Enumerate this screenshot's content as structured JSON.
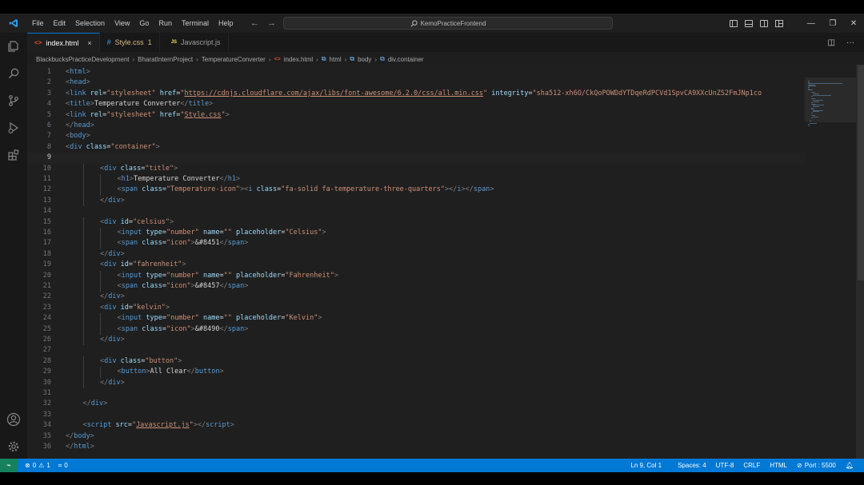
{
  "menu": [
    "File",
    "Edit",
    "Selection",
    "View",
    "Go",
    "Run",
    "Terminal",
    "Help"
  ],
  "command_center": {
    "text": "KemoPracticeFrontend"
  },
  "tabs": [
    {
      "label": "index.html",
      "icon": "html-file-icon",
      "active": true,
      "close": "×"
    },
    {
      "label": "Style.css",
      "icon": "css-file-icon",
      "badge": "1"
    },
    {
      "label": "Javascript.js",
      "icon": "js-file-icon"
    }
  ],
  "breadcrumb": [
    "BlackbucksPracticeDevelopment",
    "BharatInternProject",
    "TemperatureConverter",
    "index.html",
    "html",
    "body",
    "div.container"
  ],
  "editor": {
    "current_line": 9,
    "lines": [
      {
        "n": "1",
        "i": 0,
        "t": [
          [
            "p",
            "<"
          ],
          [
            "g",
            "html"
          ],
          [
            "p",
            ">"
          ]
        ]
      },
      {
        "n": "2",
        "i": 0,
        "t": [
          [
            "p",
            "<"
          ],
          [
            "g",
            "head"
          ],
          [
            "p",
            ">"
          ]
        ]
      },
      {
        "n": "3",
        "i": 0,
        "t": [
          [
            "p",
            "<"
          ],
          [
            "g",
            "link "
          ],
          [
            "a",
            "rel"
          ],
          [
            "x",
            "="
          ],
          [
            "s",
            "\"stylesheet\" "
          ],
          [
            "a",
            "href"
          ],
          [
            "x",
            "="
          ],
          [
            "s",
            "\""
          ],
          [
            "u",
            "https://cdnjs.cloudflare.com/ajax/libs/font-awesome/6.2.0/css/all.min.css"
          ],
          [
            "s",
            "\" "
          ],
          [
            "a",
            "integrity"
          ],
          [
            "x",
            "="
          ],
          [
            "s",
            "\"sha512-xh6O/CkQoPOWDdYTDqeRdPCVd1SpvCA9XXcUnZS2FmJNp1co"
          ]
        ]
      },
      {
        "n": "4",
        "i": 0,
        "t": [
          [
            "p",
            "<"
          ],
          [
            "g",
            "title"
          ],
          [
            "p",
            ">"
          ],
          [
            "x",
            "Temperature Converter"
          ],
          [
            "p",
            "</"
          ],
          [
            "g",
            "title"
          ],
          [
            "p",
            ">"
          ]
        ]
      },
      {
        "n": "5",
        "i": 0,
        "t": [
          [
            "p",
            "<"
          ],
          [
            "g",
            "link "
          ],
          [
            "a",
            "rel"
          ],
          [
            "x",
            "="
          ],
          [
            "s",
            "\"stylesheet\" "
          ],
          [
            "a",
            "href"
          ],
          [
            "x",
            "="
          ],
          [
            "s",
            "\""
          ],
          [
            "u",
            "Style.css"
          ],
          [
            "s",
            "\""
          ],
          [
            "p",
            ">"
          ]
        ]
      },
      {
        "n": "6",
        "i": 0,
        "t": [
          [
            "p",
            "</"
          ],
          [
            "g",
            "head"
          ],
          [
            "p",
            ">"
          ]
        ]
      },
      {
        "n": "7",
        "i": 0,
        "t": [
          [
            "p",
            "<"
          ],
          [
            "g",
            "body"
          ],
          [
            "p",
            ">"
          ]
        ]
      },
      {
        "n": "8",
        "i": 0,
        "t": [
          [
            "p",
            "<"
          ],
          [
            "g",
            "div "
          ],
          [
            "a",
            "class"
          ],
          [
            "x",
            "="
          ],
          [
            "s",
            "\"container\""
          ],
          [
            "p",
            ">"
          ]
        ]
      },
      {
        "n": "9",
        "i": 0,
        "t": []
      },
      {
        "n": "10",
        "i": 2,
        "t": [
          [
            "p",
            "<"
          ],
          [
            "g",
            "div "
          ],
          [
            "a",
            "class"
          ],
          [
            "x",
            "="
          ],
          [
            "s",
            "\"title\""
          ],
          [
            "p",
            ">"
          ]
        ]
      },
      {
        "n": "11",
        "i": 3,
        "t": [
          [
            "p",
            "<"
          ],
          [
            "g",
            "h1"
          ],
          [
            "p",
            ">"
          ],
          [
            "x",
            "Temperature Converter"
          ],
          [
            "p",
            "</"
          ],
          [
            "g",
            "h1"
          ],
          [
            "p",
            ">"
          ]
        ]
      },
      {
        "n": "12",
        "i": 3,
        "t": [
          [
            "p",
            "<"
          ],
          [
            "g",
            "span "
          ],
          [
            "a",
            "class"
          ],
          [
            "x",
            "="
          ],
          [
            "s",
            "\"Temperature-icon\""
          ],
          [
            "p",
            "><"
          ],
          [
            "g",
            "i "
          ],
          [
            "a",
            "class"
          ],
          [
            "x",
            "="
          ],
          [
            "s",
            "\"fa-solid fa-temperature-three-quarters\""
          ],
          [
            "p",
            "></"
          ],
          [
            "g",
            "i"
          ],
          [
            "p",
            "></"
          ],
          [
            "g",
            "span"
          ],
          [
            "p",
            ">"
          ]
        ]
      },
      {
        "n": "13",
        "i": 2,
        "t": [
          [
            "p",
            "</"
          ],
          [
            "g",
            "div"
          ],
          [
            "p",
            ">"
          ]
        ]
      },
      {
        "n": "14",
        "i": 0,
        "t": []
      },
      {
        "n": "15",
        "i": 2,
        "t": [
          [
            "p",
            "<"
          ],
          [
            "g",
            "div "
          ],
          [
            "a",
            "id"
          ],
          [
            "x",
            "="
          ],
          [
            "s",
            "\"celsius\""
          ],
          [
            "p",
            ">"
          ]
        ]
      },
      {
        "n": "16",
        "i": 3,
        "t": [
          [
            "p",
            "<"
          ],
          [
            "g",
            "input "
          ],
          [
            "a",
            "type"
          ],
          [
            "x",
            "="
          ],
          [
            "s",
            "\"number\" "
          ],
          [
            "a",
            "name"
          ],
          [
            "x",
            "="
          ],
          [
            "s",
            "\"\" "
          ],
          [
            "a",
            "placeholder"
          ],
          [
            "x",
            "="
          ],
          [
            "s",
            "\"Celsius\""
          ],
          [
            "p",
            ">"
          ]
        ]
      },
      {
        "n": "17",
        "i": 3,
        "t": [
          [
            "p",
            "<"
          ],
          [
            "g",
            "span "
          ],
          [
            "a",
            "class"
          ],
          [
            "x",
            "="
          ],
          [
            "s",
            "\"icon\""
          ],
          [
            "p",
            ">"
          ],
          [
            "x",
            "&#8451"
          ],
          [
            "p",
            "</"
          ],
          [
            "g",
            "span"
          ],
          [
            "p",
            ">"
          ]
        ]
      },
      {
        "n": "18",
        "i": 2,
        "t": [
          [
            "p",
            "</"
          ],
          [
            "g",
            "div"
          ],
          [
            "p",
            ">"
          ]
        ]
      },
      {
        "n": "19",
        "i": 2,
        "t": [
          [
            "p",
            "<"
          ],
          [
            "g",
            "div "
          ],
          [
            "a",
            "id"
          ],
          [
            "x",
            "="
          ],
          [
            "s",
            "\"fahrenheit\""
          ],
          [
            "p",
            ">"
          ]
        ]
      },
      {
        "n": "20",
        "i": 3,
        "t": [
          [
            "p",
            "<"
          ],
          [
            "g",
            "input "
          ],
          [
            "a",
            "type"
          ],
          [
            "x",
            "="
          ],
          [
            "s",
            "\"number\" "
          ],
          [
            "a",
            "name"
          ],
          [
            "x",
            "="
          ],
          [
            "s",
            "\"\" "
          ],
          [
            "a",
            "placeholder"
          ],
          [
            "x",
            "="
          ],
          [
            "s",
            "\"Fahrenheit\""
          ],
          [
            "p",
            ">"
          ]
        ]
      },
      {
        "n": "21",
        "i": 3,
        "t": [
          [
            "p",
            "<"
          ],
          [
            "g",
            "span "
          ],
          [
            "a",
            "class"
          ],
          [
            "x",
            "="
          ],
          [
            "s",
            "\"icon\""
          ],
          [
            "p",
            ">"
          ],
          [
            "x",
            "&#8457"
          ],
          [
            "p",
            "</"
          ],
          [
            "g",
            "span"
          ],
          [
            "p",
            ">"
          ]
        ]
      },
      {
        "n": "22",
        "i": 2,
        "t": [
          [
            "p",
            "</"
          ],
          [
            "g",
            "div"
          ],
          [
            "p",
            ">"
          ]
        ]
      },
      {
        "n": "23",
        "i": 2,
        "t": [
          [
            "p",
            "<"
          ],
          [
            "g",
            "div "
          ],
          [
            "a",
            "id"
          ],
          [
            "x",
            "="
          ],
          [
            "s",
            "\"kelvin\""
          ],
          [
            "p",
            ">"
          ]
        ]
      },
      {
        "n": "24",
        "i": 3,
        "t": [
          [
            "p",
            "<"
          ],
          [
            "g",
            "input "
          ],
          [
            "a",
            "type"
          ],
          [
            "x",
            "="
          ],
          [
            "s",
            "\"number\" "
          ],
          [
            "a",
            "name"
          ],
          [
            "x",
            "="
          ],
          [
            "s",
            "\"\" "
          ],
          [
            "a",
            "placeholder"
          ],
          [
            "x",
            "="
          ],
          [
            "s",
            "\"Kelvin\""
          ],
          [
            "p",
            ">"
          ]
        ]
      },
      {
        "n": "25",
        "i": 3,
        "t": [
          [
            "p",
            "<"
          ],
          [
            "g",
            "span "
          ],
          [
            "a",
            "class"
          ],
          [
            "x",
            "="
          ],
          [
            "s",
            "\"icon\""
          ],
          [
            "p",
            ">"
          ],
          [
            "x",
            "&#8490"
          ],
          [
            "p",
            "</"
          ],
          [
            "g",
            "span"
          ],
          [
            "p",
            ">"
          ]
        ]
      },
      {
        "n": "26",
        "i": 2,
        "t": [
          [
            "p",
            "</"
          ],
          [
            "g",
            "div"
          ],
          [
            "p",
            ">"
          ]
        ]
      },
      {
        "n": "27",
        "i": 0,
        "t": []
      },
      {
        "n": "28",
        "i": 2,
        "t": [
          [
            "p",
            "<"
          ],
          [
            "g",
            "div "
          ],
          [
            "a",
            "class"
          ],
          [
            "x",
            "="
          ],
          [
            "s",
            "\"button\""
          ],
          [
            "p",
            ">"
          ]
        ]
      },
      {
        "n": "29",
        "i": 3,
        "t": [
          [
            "p",
            "<"
          ],
          [
            "g",
            "button"
          ],
          [
            "p",
            ">"
          ],
          [
            "x",
            "All Clear"
          ],
          [
            "p",
            "</"
          ],
          [
            "g",
            "button"
          ],
          [
            "p",
            ">"
          ]
        ]
      },
      {
        "n": "30",
        "i": 2,
        "t": [
          [
            "p",
            "</"
          ],
          [
            "g",
            "div"
          ],
          [
            "p",
            ">"
          ]
        ]
      },
      {
        "n": "31",
        "i": 0,
        "t": []
      },
      {
        "n": "32",
        "i": 1,
        "t": [
          [
            "p",
            "</"
          ],
          [
            "g",
            "div"
          ],
          [
            "p",
            ">"
          ]
        ]
      },
      {
        "n": "33",
        "i": 0,
        "t": []
      },
      {
        "n": "34",
        "i": 1,
        "t": [
          [
            "p",
            "<"
          ],
          [
            "g",
            "script "
          ],
          [
            "a",
            "src"
          ],
          [
            "x",
            "="
          ],
          [
            "s",
            "\""
          ],
          [
            "u",
            "Javascript.js"
          ],
          [
            "s",
            "\""
          ],
          [
            "p",
            "></"
          ],
          [
            "g",
            "script"
          ],
          [
            "p",
            ">"
          ]
        ]
      },
      {
        "n": "35",
        "i": 0,
        "t": [
          [
            "p",
            "</"
          ],
          [
            "g",
            "body"
          ],
          [
            "p",
            ">"
          ]
        ]
      },
      {
        "n": "36",
        "i": 0,
        "t": [
          [
            "p",
            "</"
          ],
          [
            "g",
            "html"
          ],
          [
            "p",
            ">"
          ]
        ]
      }
    ]
  },
  "statusbar": {
    "remote": "⌁",
    "errors": "0",
    "warnings": "1",
    "ports_count": "0",
    "position": "Ln 9, Col 1",
    "spaces": "Spaces: 4",
    "encoding": "UTF-8",
    "eol": "CRLF",
    "language": "HTML",
    "port": "Port : 5500"
  },
  "colors": {
    "accent": "#0078d4",
    "tag": "#569cd6",
    "attribute": "#9cdcfe",
    "string": "#ce9178",
    "punctuation": "#808080"
  }
}
